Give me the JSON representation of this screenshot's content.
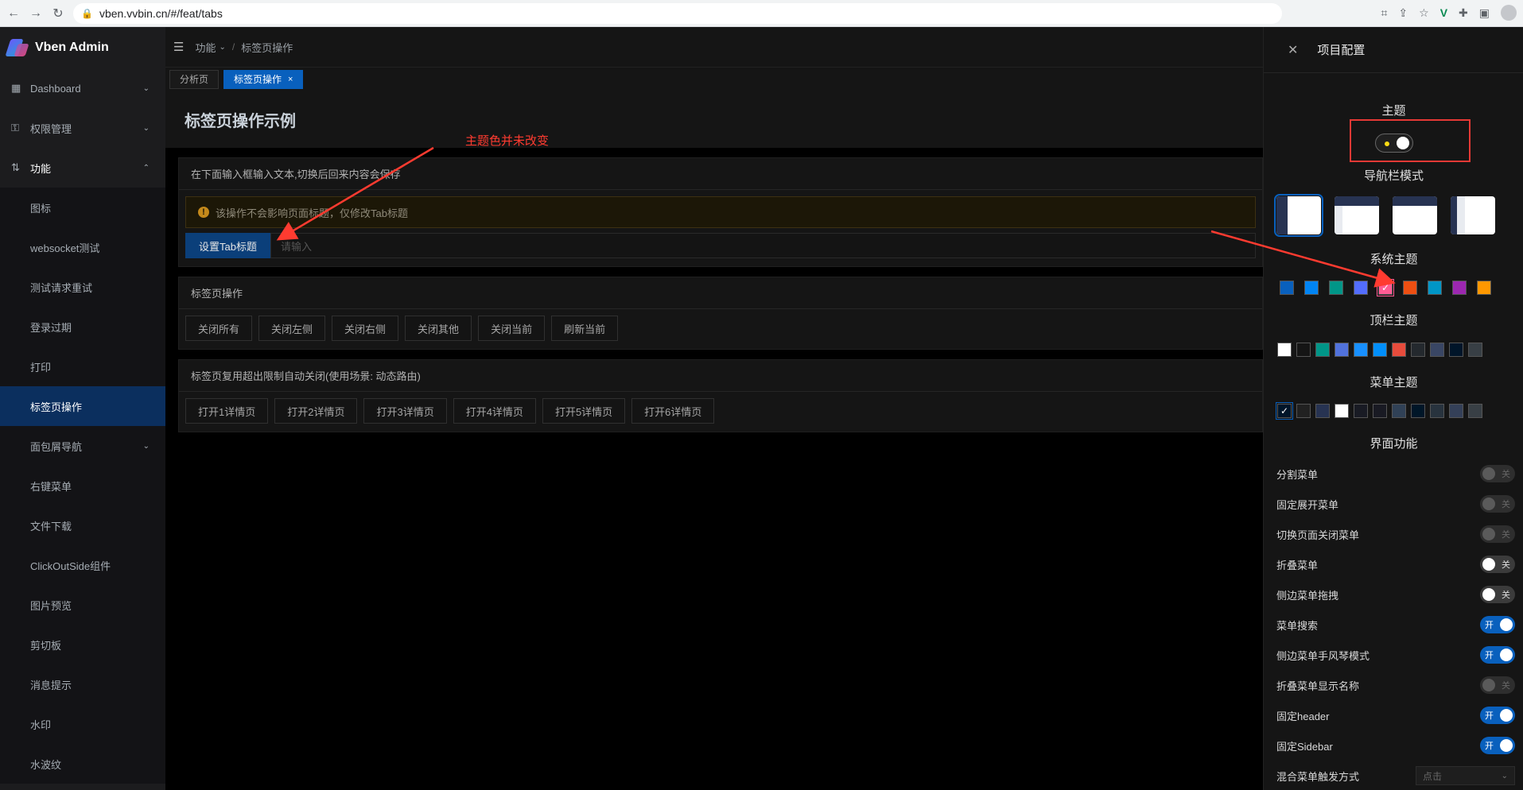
{
  "browser": {
    "url": "vben.vvbin.cn/#/feat/tabs"
  },
  "app": {
    "name": "Vben Admin"
  },
  "sidebar": {
    "items": [
      {
        "label": "Dashboard",
        "icon": "dashboard-icon"
      },
      {
        "label": "权限管理",
        "icon": "key-icon"
      },
      {
        "label": "功能",
        "icon": "feature-icon"
      }
    ],
    "sub_items": [
      "图标",
      "websocket测试",
      "测试请求重试",
      "登录过期",
      "打印",
      "标签页操作",
      "面包屑导航",
      "右键菜单",
      "文件下载",
      "ClickOutSide组件",
      "图片预览",
      "剪切板",
      "消息提示",
      "水印",
      "水波纹"
    ]
  },
  "header": {
    "breadcrumb_1": "功能",
    "breadcrumb_2": "标签页操作"
  },
  "tabs": [
    {
      "label": "分析页"
    },
    {
      "label": "标签页操作"
    }
  ],
  "page": {
    "title": "标签页操作示例",
    "card1": {
      "title": "在下面输入框输入文本,切换后回来内容会保存",
      "alert": "该操作不会影响页面标题，仅修改Tab标题",
      "button": "设置Tab标题",
      "placeholder": "请输入"
    },
    "card2": {
      "title": "标签页操作",
      "buttons": [
        "关闭所有",
        "关闭左侧",
        "关闭右侧",
        "关闭其他",
        "关闭当前",
        "刷新当前"
      ]
    },
    "card3": {
      "title": "标签页复用超出限制自动关闭(使用场景: 动态路由)",
      "buttons": [
        "打开1详情页",
        "打开2详情页",
        "打开3详情页",
        "打开4详情页",
        "打开5详情页",
        "打开6详情页"
      ]
    }
  },
  "annotation": {
    "text": "主题色并未改变"
  },
  "drawer": {
    "title": "项目配置",
    "theme_title": "主题",
    "nav_mode_title": "导航栏模式",
    "system_theme_title": "系统主题",
    "system_colors": [
      "#0960bd",
      "#0084f4",
      "#009688",
      "#536dfe",
      "#ff5c93",
      "#ee4f12",
      "#0096c7",
      "#9c27b0",
      "#ff9800"
    ],
    "top_theme_title": "顶栏主题",
    "top_colors": [
      "#ffffff",
      "#151515",
      "#009688",
      "#5172dc",
      "#1890ff",
      "#018ffb",
      "#e74c3c",
      "#24292e",
      "#394664",
      "#001529",
      "#383f45"
    ],
    "menu_theme_title": "菜单主题",
    "menu_colors": [
      "#001529",
      "#212121",
      "#273352",
      "#ffffff",
      "#191b24",
      "#191a23",
      "#304156",
      "#001628",
      "#28333e",
      "#344058",
      "#383f45"
    ],
    "features_title": "界面功能",
    "features": [
      {
        "label": "分割菜单",
        "state": "关"
      },
      {
        "label": "固定展开菜单",
        "state": "关"
      },
      {
        "label": "切换页面关闭菜单",
        "state": "关"
      },
      {
        "label": "折叠菜单",
        "state": "关"
      },
      {
        "label": "侧边菜单拖拽",
        "state": "关"
      },
      {
        "label": "菜单搜索",
        "state": "开"
      },
      {
        "label": "侧边菜单手风琴模式",
        "state": "开"
      },
      {
        "label": "折叠菜单显示名称",
        "state": "关"
      },
      {
        "label": "固定header",
        "state": "开"
      },
      {
        "label": "固定Sidebar",
        "state": "开"
      },
      {
        "label": "混合菜单触发方式",
        "state": ""
      }
    ],
    "mix_trigger_value": "点击"
  }
}
